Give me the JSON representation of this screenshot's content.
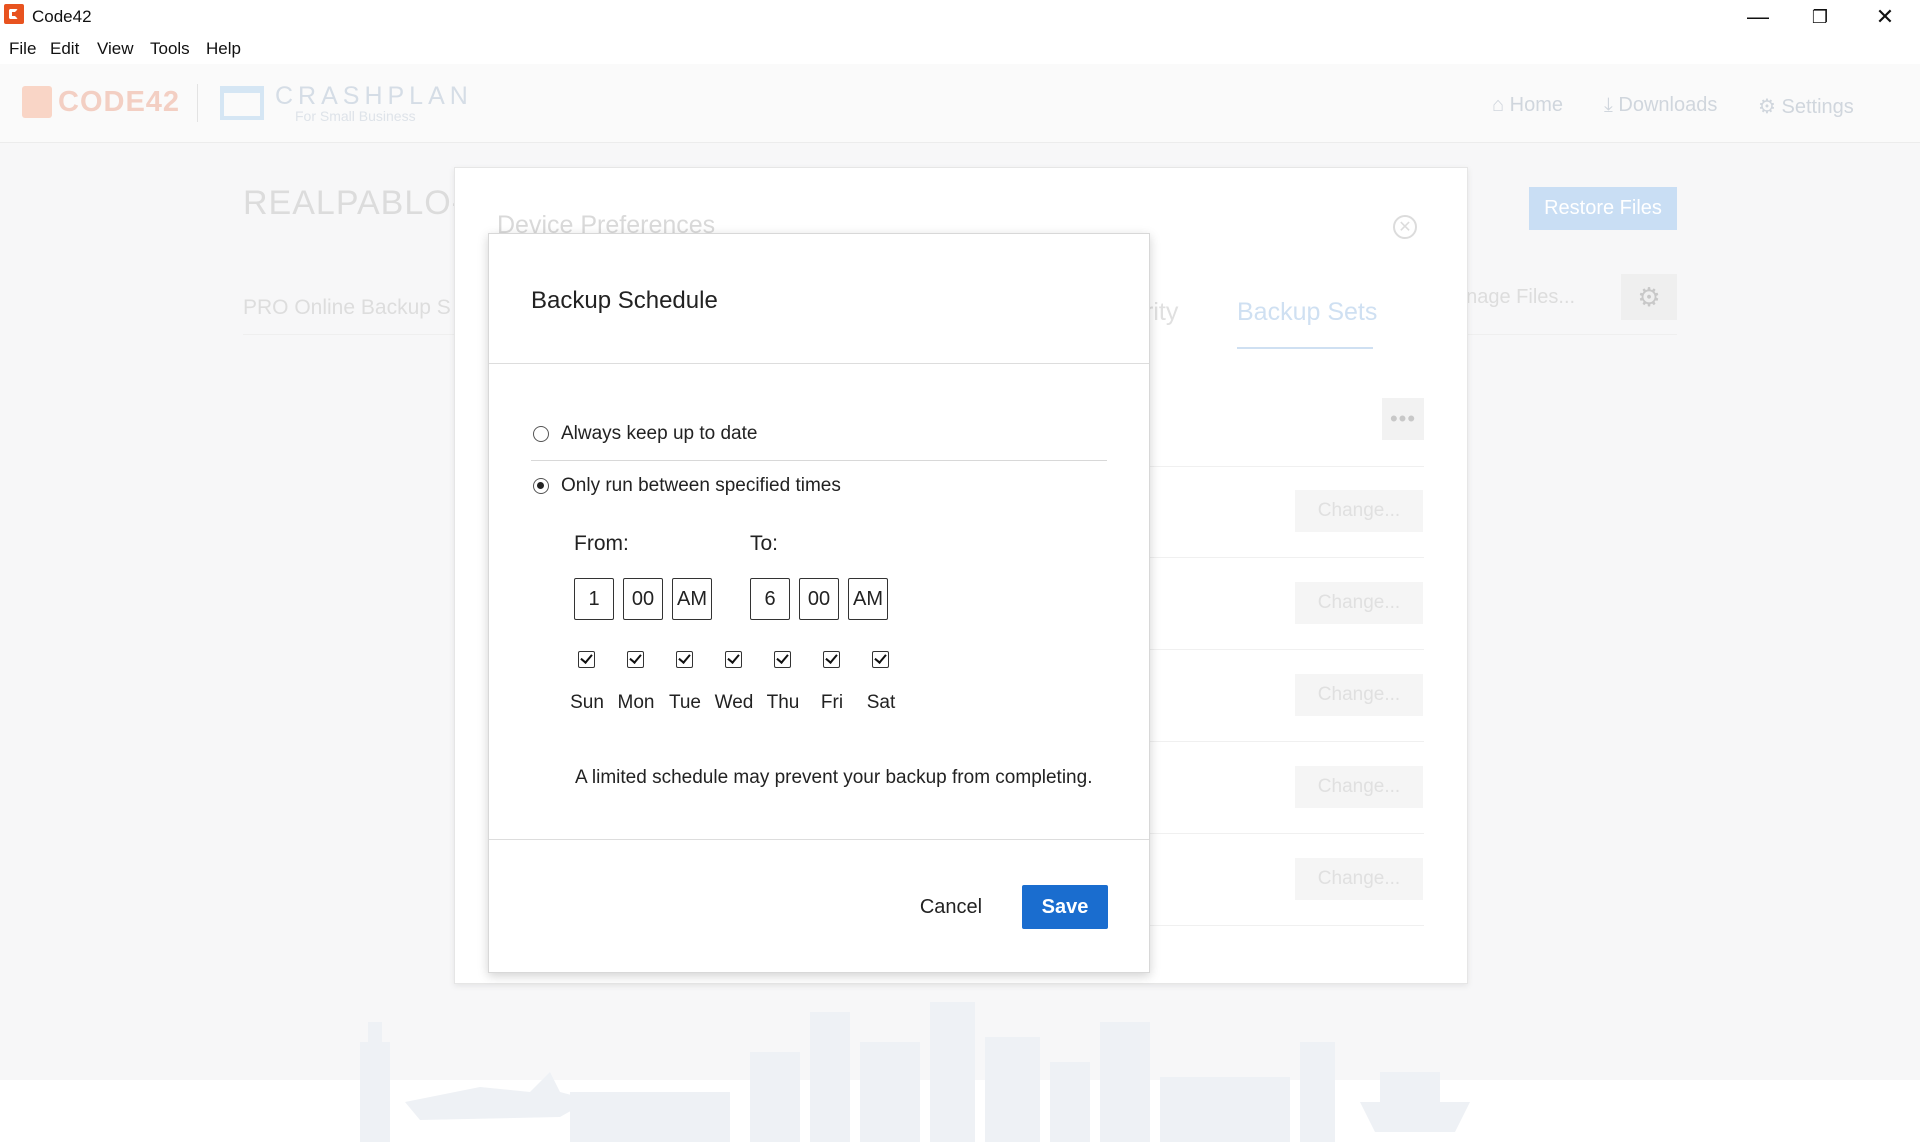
{
  "window": {
    "title": "Code42",
    "minimize_glyph": "—",
    "restore_glyph": "❐",
    "close_glyph": "✕"
  },
  "menu": [
    "File",
    "Edit",
    "View",
    "Tools",
    "Help"
  ],
  "background": {
    "logo_code42": "CODE42",
    "logo_crashplan": "CRASHPLAN",
    "logo_crashplan_sub": "For Small Business",
    "nav": {
      "home": "Home",
      "downloads": "Downloads",
      "settings": "Settings"
    },
    "device_name": "REALPABLO-P",
    "restore_button": "Restore Files",
    "manage_files": "anage Files...",
    "pro_label": "PRO Online Backup S",
    "panel": {
      "title": "Device Preferences",
      "tab_security_fragment": "rity",
      "tab_backup_sets": "Backup Sets",
      "more_glyph": "•••",
      "change_buttons": [
        "Change...",
        "Change...",
        "Change...",
        "Change...",
        "Change..."
      ]
    }
  },
  "modal": {
    "title": "Backup Schedule",
    "options": [
      {
        "label": "Always keep up to date",
        "selected": false
      },
      {
        "label": "Only run between specified times",
        "selected": true
      }
    ],
    "from_label": "From:",
    "to_label": "To:",
    "from": {
      "hour": "1",
      "minute": "00",
      "ampm": "AM"
    },
    "to": {
      "hour": "6",
      "minute": "00",
      "ampm": "AM"
    },
    "days": [
      {
        "label": "Sun",
        "checked": true
      },
      {
        "label": "Mon",
        "checked": true
      },
      {
        "label": "Tue",
        "checked": true
      },
      {
        "label": "Wed",
        "checked": true
      },
      {
        "label": "Thu",
        "checked": true
      },
      {
        "label": "Fri",
        "checked": true
      },
      {
        "label": "Sat",
        "checked": true
      }
    ],
    "warning": "A limited schedule may prevent your backup from completing.",
    "cancel_label": "Cancel",
    "save_label": "Save"
  },
  "colors": {
    "accent": "#1a6dcf",
    "brand": "#e8531f"
  }
}
